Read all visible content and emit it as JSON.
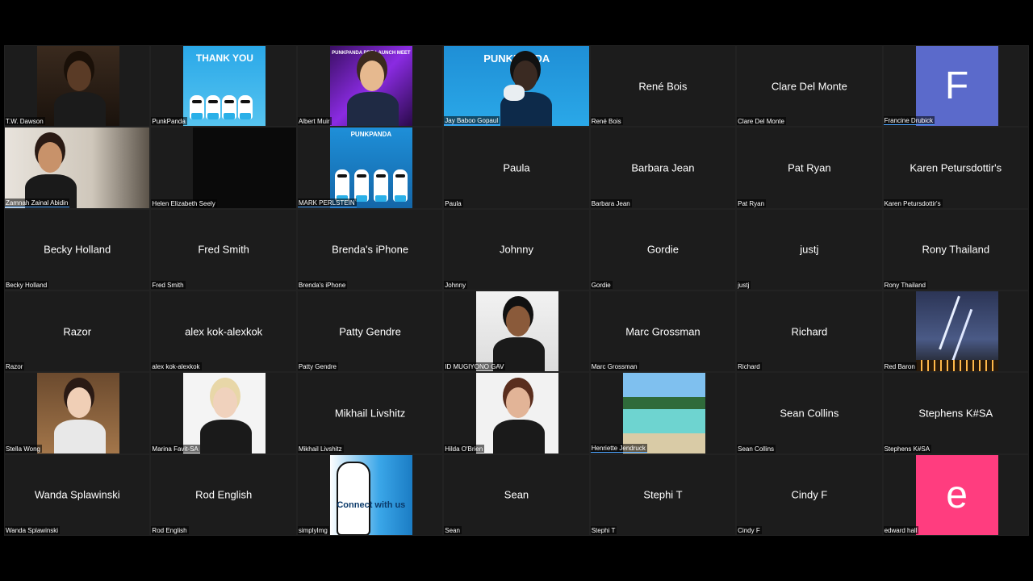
{
  "meeting": {
    "colors": {
      "background": "#000000",
      "tile": "#1c1c1c",
      "speaking": "#4aa3ff"
    },
    "participants": [
      {
        "label": "T.W. Dawson",
        "kind": "video"
      },
      {
        "label": "PunkPanda",
        "kind": "image",
        "overlay": "THANK YOU"
      },
      {
        "label": "Albert Muir",
        "kind": "image",
        "overlay": "PUNKPANDA PRE-LAUNCH MEET"
      },
      {
        "label": "Jay Baboo Gopaul",
        "kind": "video",
        "overlay": "PUNKPANDA",
        "speaking": true
      },
      {
        "label": "René Bois",
        "name": "René Bois",
        "kind": "name"
      },
      {
        "label": "Clare Del Monte",
        "name": "Clare Del Monte",
        "kind": "name"
      },
      {
        "label": "Francine Drubick",
        "kind": "avatar",
        "letter": "F",
        "color": "#5b6acb",
        "speaking": true
      },
      {
        "label": "Zamnah Zainal Abidin",
        "kind": "video",
        "speaking": true
      },
      {
        "label": "Helen Elizabeth Seely",
        "kind": "video"
      },
      {
        "label": "MARK PERLSTEIN",
        "kind": "image",
        "overlay": "PUNKPANDA",
        "speaking": true
      },
      {
        "label": "Paula",
        "name": "Paula",
        "kind": "name"
      },
      {
        "label": "Barbara Jean",
        "name": "Barbara Jean",
        "kind": "name"
      },
      {
        "label": "Pat Ryan",
        "name": "Pat Ryan",
        "kind": "name"
      },
      {
        "label": "Karen Petursdottir's",
        "name": "Karen Petursdottir's",
        "kind": "name"
      },
      {
        "label": "Becky Holland",
        "name": "Becky Holland",
        "kind": "name"
      },
      {
        "label": "Fred Smith",
        "name": "Fred Smith",
        "kind": "name"
      },
      {
        "label": "Brenda's iPhone",
        "name": "Brenda's iPhone",
        "kind": "name"
      },
      {
        "label": "Johnny",
        "name": "Johnny",
        "kind": "name"
      },
      {
        "label": "Gordie",
        "name": "Gordie",
        "kind": "name"
      },
      {
        "label": "justj",
        "name": "justj",
        "kind": "name"
      },
      {
        "label": "Rony Thailand",
        "name": "Rony Thailand",
        "kind": "name"
      },
      {
        "label": "Razor",
        "name": "Razor",
        "kind": "name"
      },
      {
        "label": "alex kok-alexkok",
        "name": "alex kok-alexkok",
        "kind": "name"
      },
      {
        "label": "Patty Gendre",
        "name": "Patty Gendre",
        "kind": "name"
      },
      {
        "label": "ID  MUGIYONO GAV",
        "kind": "photo"
      },
      {
        "label": "Marc Grossman",
        "name": "Marc Grossman",
        "kind": "name"
      },
      {
        "label": "Richard",
        "name": "Richard",
        "kind": "name"
      },
      {
        "label": "Red Baron",
        "kind": "image"
      },
      {
        "label": "Stella Wong",
        "kind": "photo"
      },
      {
        "label": "Marina Favit-SA",
        "kind": "photo"
      },
      {
        "label": "Mikhail Livshitz",
        "name": "Mikhail Livshitz",
        "kind": "name"
      },
      {
        "label": "Hilda O'Brien",
        "kind": "photo"
      },
      {
        "label": "Henriette Jendruck",
        "kind": "image",
        "speaking": true
      },
      {
        "label": "Sean Collins",
        "name": "Sean Collins",
        "kind": "name"
      },
      {
        "label": "Stephens K#SA",
        "name": "Stephens K#SA",
        "kind": "name"
      },
      {
        "label": "Wanda Splawinski",
        "name": "Wanda Splawinski",
        "kind": "name"
      },
      {
        "label": "Rod English",
        "name": "Rod English",
        "kind": "name"
      },
      {
        "label": "simplyImg",
        "kind": "image",
        "overlay": "Connect with us"
      },
      {
        "label": "Sean",
        "name": "Sean",
        "kind": "name"
      },
      {
        "label": "Stephi T",
        "name": "Stephi T",
        "kind": "name"
      },
      {
        "label": "Cindy F",
        "name": "Cindy F",
        "kind": "name"
      },
      {
        "label": "edward hall",
        "kind": "avatar",
        "letter": "e",
        "color": "#ff3d7f"
      }
    ]
  }
}
